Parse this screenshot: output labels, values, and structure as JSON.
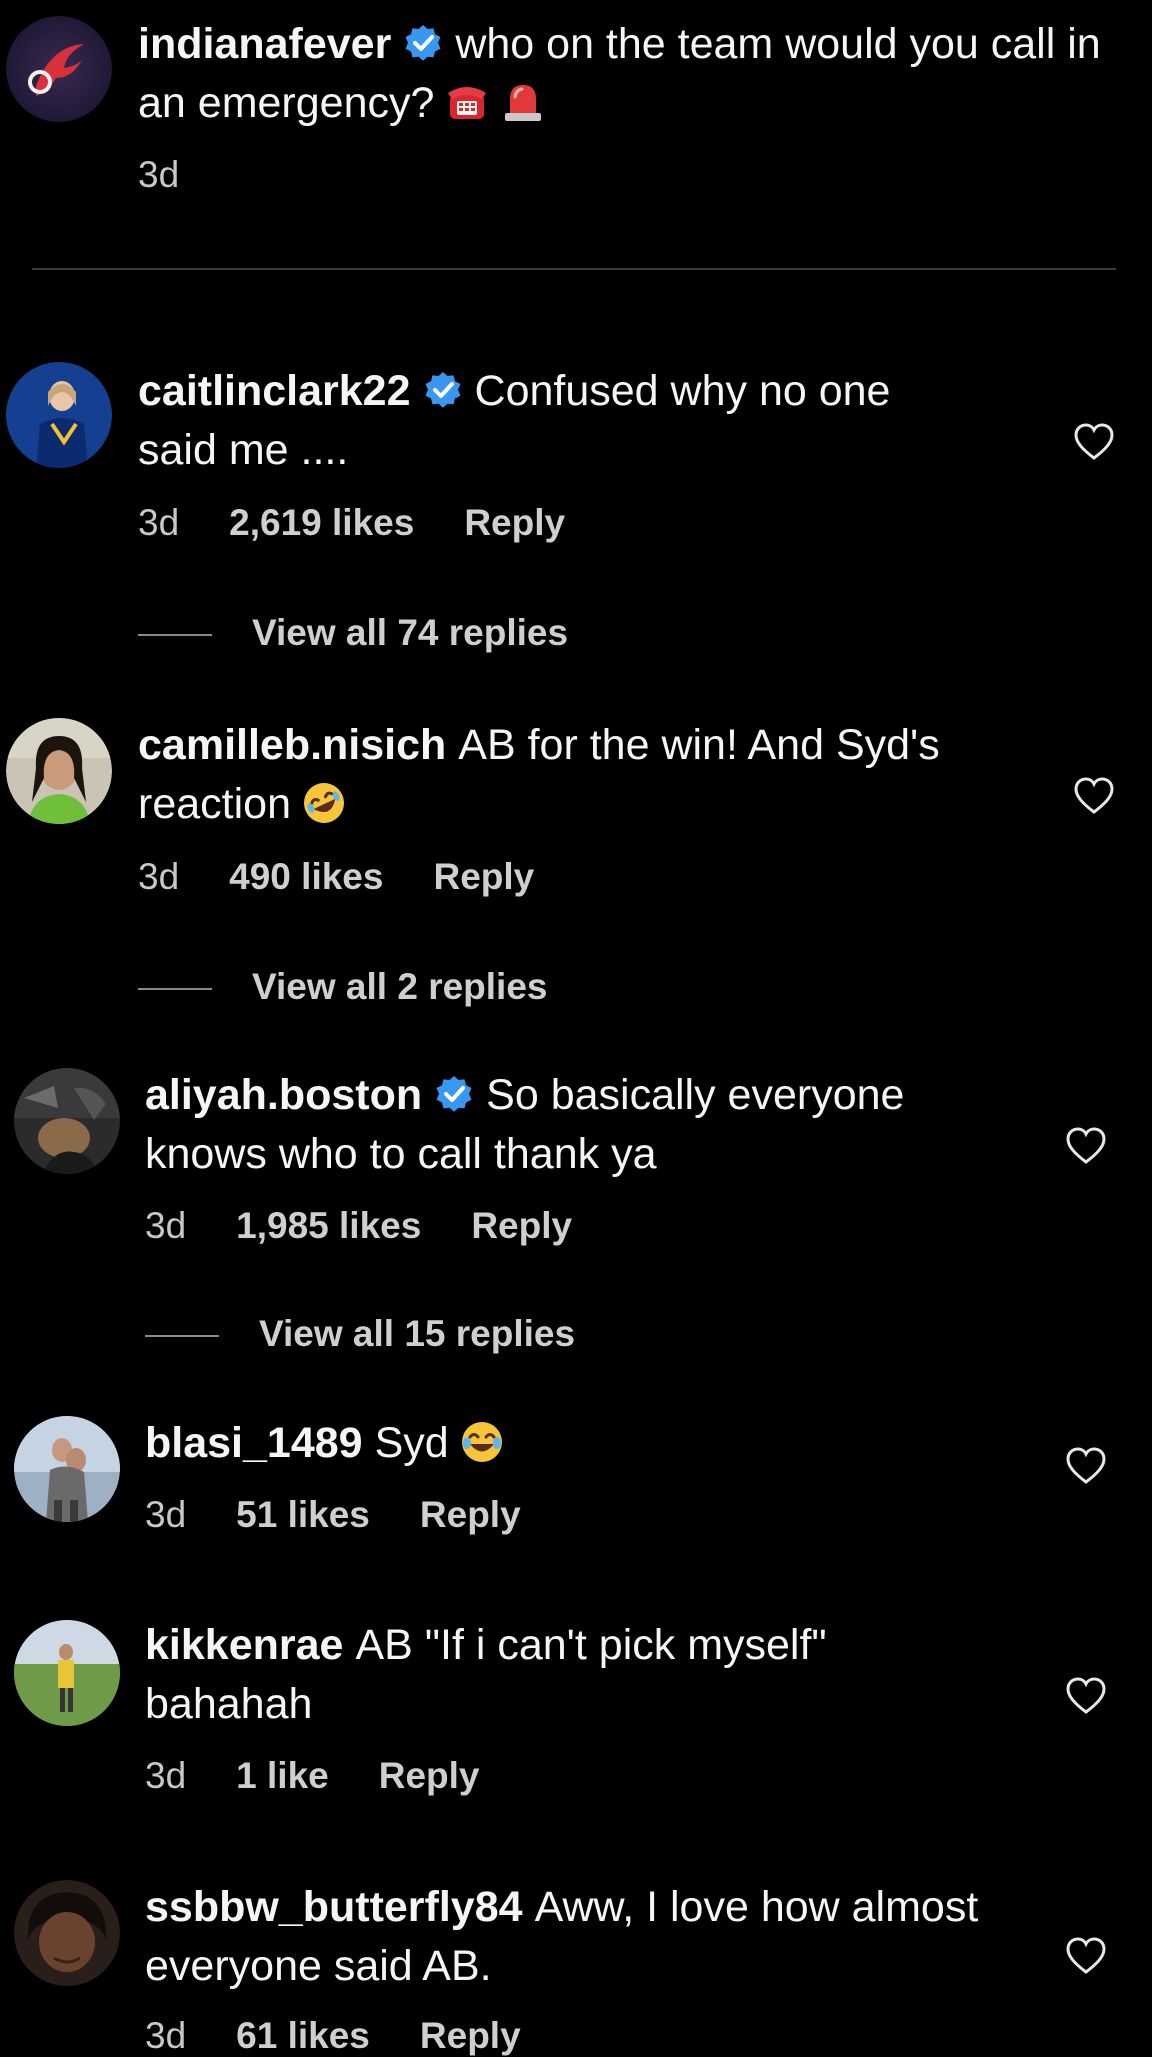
{
  "post": {
    "username": "indianafever",
    "verified": true,
    "caption_line1": "who on the team would you call in",
    "caption_line2": "an emergency?",
    "time": "3d",
    "emojis": [
      "telephone-icon",
      "siren-icon"
    ]
  },
  "comments": [
    {
      "username": "caitlinclark22",
      "verified": true,
      "line1": "Confused why no one",
      "line2": "said me ....",
      "time": "3d",
      "likes": "2,619 likes",
      "reply": "Reply",
      "view_replies": "View all 74 replies"
    },
    {
      "username": "camilleb.nisich",
      "verified": false,
      "line1": "AB for the win! And Syd's",
      "line2": "reaction",
      "emoji": "rolling-laughing-icon",
      "time": "3d",
      "likes": "490 likes",
      "reply": "Reply",
      "view_replies": "View all 2 replies"
    },
    {
      "username": "aliyah.boston",
      "verified": true,
      "line1": "So basically everyone",
      "line2": "knows who to call thank ya",
      "time": "3d",
      "likes": "1,985 likes",
      "reply": "Reply",
      "view_replies": "View all 15 replies"
    },
    {
      "username": "blasi_1489",
      "verified": false,
      "line1": "Syd",
      "emoji": "tears-of-joy-icon",
      "time": "3d",
      "likes": "51 likes",
      "reply": "Reply"
    },
    {
      "username": "kikkenrae",
      "verified": false,
      "line1": "AB \"If i can't pick myself\"",
      "line2": "bahahah",
      "time": "3d",
      "likes": "1 like",
      "reply": "Reply"
    },
    {
      "username": "ssbbw_butterfly84",
      "verified": false,
      "line1": "Aww, I love how almost",
      "line2": "everyone said AB.",
      "time": "3d",
      "likes": "61 likes",
      "reply": "Reply"
    }
  ],
  "colors": {
    "background": "#000000",
    "verified_blue": "#3897f0",
    "text": "#f5f5f5",
    "secondary_text": "#c8c8c8"
  }
}
